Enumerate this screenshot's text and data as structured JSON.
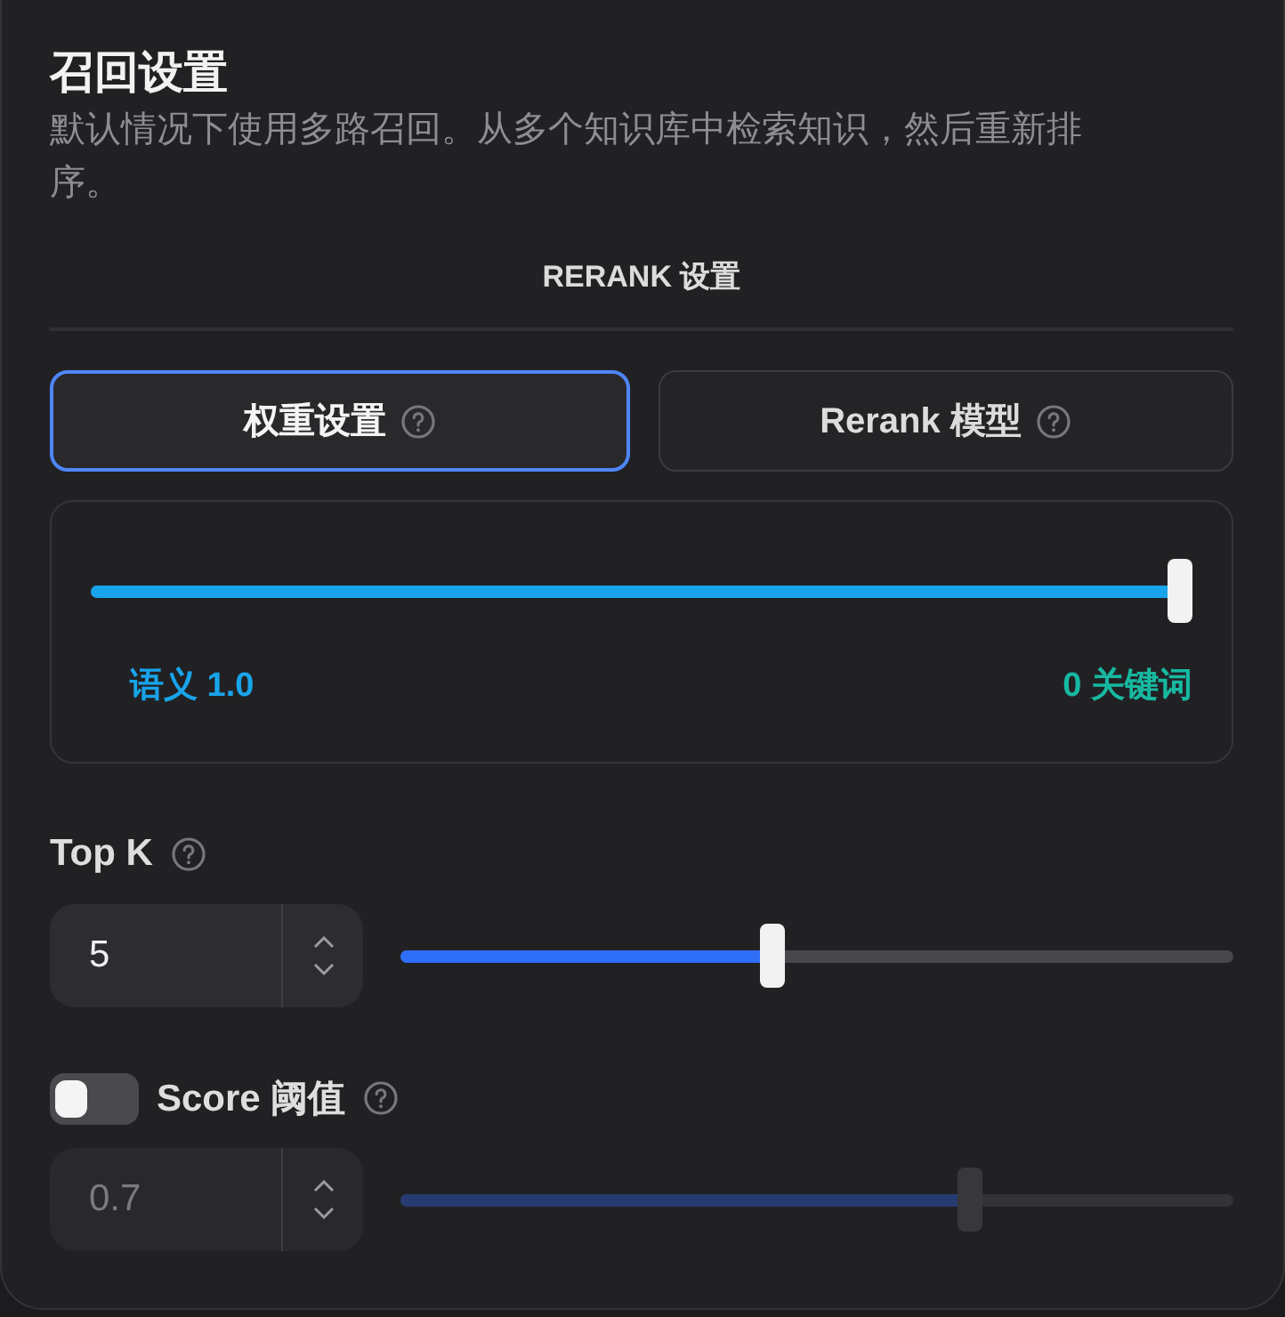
{
  "panel": {
    "title": "召回设置",
    "description": "默认情况下使用多路召回。从多个知识库中检索知识，然后重新排序。"
  },
  "section_title": "RERANK 设置",
  "tabs": [
    {
      "label": "权重设置",
      "selected": true
    },
    {
      "label": "Rerank 模型",
      "selected": false
    }
  ],
  "weight": {
    "level": 1,
    "left_label": "语义 1.0",
    "right_label": "0 关键词"
  },
  "params": [
    {
      "kind": "plain",
      "label": "Top K",
      "value": "5",
      "level": 0.445,
      "disabled": false
    },
    {
      "kind": "toggle",
      "label": "Score 阈值",
      "on": false,
      "value": "0.7",
      "level": 0.69,
      "disabled": true
    }
  ]
}
